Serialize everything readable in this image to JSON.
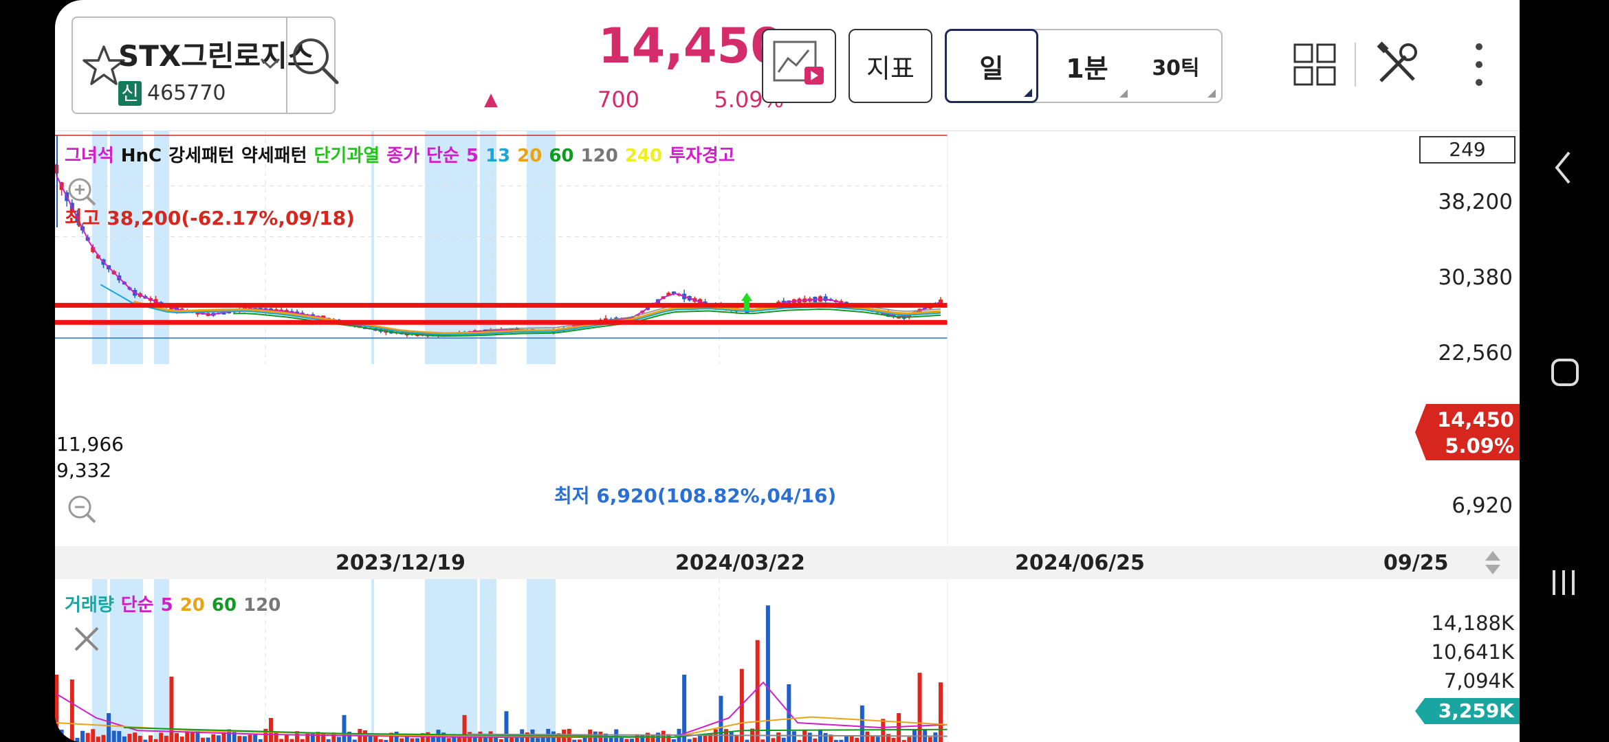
{
  "header": {
    "stock_name": "STX그린로지스",
    "badge": "신",
    "code": "465770",
    "price": "14,450",
    "change_arrow": "▲",
    "change": "700",
    "change_pct": "5.09%"
  },
  "toolbar": {
    "indicator_label": "지표",
    "period_day": "일",
    "period_minute": "1분",
    "period_tick": "30틱"
  },
  "legend": {
    "items": [
      {
        "text": "그녀석",
        "color": "#d11ec8"
      },
      {
        "text": "HnC",
        "color": "#111111"
      },
      {
        "text": "강세패턴",
        "color": "#111111"
      },
      {
        "text": "약세패턴",
        "color": "#111111"
      },
      {
        "text": "단기과열",
        "color": "#22c41a"
      },
      {
        "text": "종가",
        "color": "#d11ec8"
      },
      {
        "text": "단순",
        "color": "#d11ec8"
      },
      {
        "text": "5",
        "color": "#d11ec8"
      },
      {
        "text": "13",
        "color": "#1aa6d6"
      },
      {
        "text": "20",
        "color": "#e8a317"
      },
      {
        "text": "60",
        "color": "#119922"
      },
      {
        "text": "120",
        "color": "#777777"
      },
      {
        "text": "240",
        "color": "#eeee22"
      },
      {
        "text": "투자경고",
        "color": "#d11ec8"
      }
    ]
  },
  "price_chart": {
    "count_box": "249",
    "high_label": "최고 38,200(-62.17%,09/18)",
    "low_label": "최저 6,920(108.82%,04/16)",
    "line1_label": "11,966",
    "line2_label": "9,332",
    "y_ticks": [
      "38,200",
      "30,380",
      "22,560",
      "6,920"
    ],
    "current_price_tag": "14,450",
    "current_pct_tag": "5.09%",
    "x_ticks": [
      "2023/12/19",
      "2024/03/22",
      "2024/06/25",
      "09/25"
    ]
  },
  "volume_chart": {
    "legend": [
      {
        "text": "거래량",
        "color": "#1aa6a0"
      },
      {
        "text": "단순",
        "color": "#d11ec8"
      },
      {
        "text": "5",
        "color": "#d11ec8"
      },
      {
        "text": "20",
        "color": "#e8a317"
      },
      {
        "text": "60",
        "color": "#119922"
      },
      {
        "text": "120",
        "color": "#777777"
      }
    ],
    "y_ticks": [
      "14,188K",
      "10,641K",
      "7,094K"
    ],
    "current_tag": "3,259K"
  },
  "chart_data": {
    "type": "candlestick",
    "y_ticks_printed": [
      38200,
      30380,
      22560,
      6920
    ],
    "high": 38200,
    "low": 6920,
    "current": 14450,
    "horizontal_lines": [
      11966,
      9332
    ],
    "x_ticks": [
      "2023/12/19",
      "2024/03/22",
      "2024/06/25",
      "09/25"
    ],
    "volume_ticks_K": [
      14188,
      10641,
      7094
    ],
    "volume_current_K": 3259,
    "series": [
      {
        "name": "5",
        "values_approx": [
          32000,
          20000,
          14000,
          11500,
          10500,
          11500,
          11000,
          10000,
          8500,
          7600,
          7300,
          8000,
          8200,
          8000,
          9500,
          10000,
          14000,
          12000,
          11000,
          12500,
          13000,
          11500,
          10000,
          12500
        ]
      },
      {
        "name": "20",
        "values_approx": [
          23000,
          16000,
          12500,
          11000,
          11200,
          11300,
          10700,
          9800,
          9000,
          8000,
          7600,
          7700,
          8000,
          8100,
          9000,
          9800,
          11500,
          11700,
          11200,
          11800,
          12000,
          11500,
          10600,
          11000
        ]
      }
    ]
  },
  "icons": {
    "favorite": "star-icon",
    "dropdown": "chevron-down-icon",
    "search": "search-icon",
    "chart_video": "chart-video-icon",
    "layout": "grid-icon",
    "tools": "tools-icon",
    "more": "kebab-icon",
    "zoom_in": "zoom-in-icon",
    "zoom_out": "zoom-out-icon",
    "close": "close-icon"
  }
}
